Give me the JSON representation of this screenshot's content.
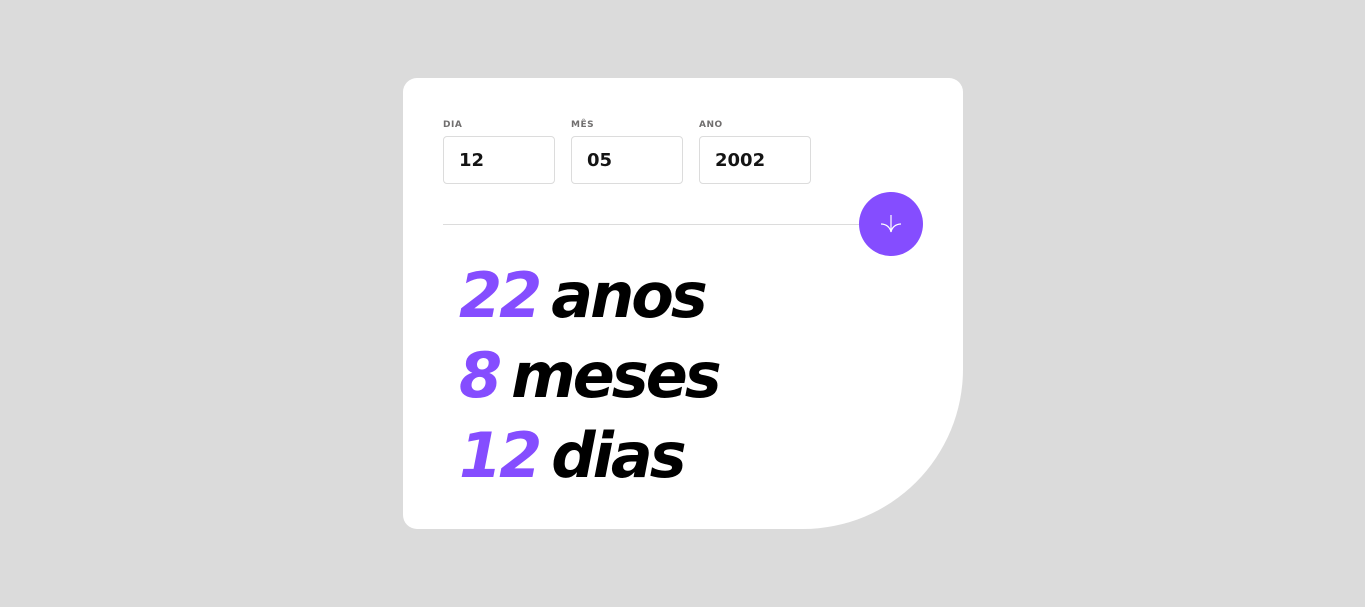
{
  "form": {
    "fields": [
      {
        "label": "DIA",
        "value": "12"
      },
      {
        "label": "MÊS",
        "value": "05"
      },
      {
        "label": "ANO",
        "value": "2002"
      }
    ],
    "submit_icon": "arrow-down-icon"
  },
  "results": [
    {
      "value": "22",
      "unit": "anos"
    },
    {
      "value": "8",
      "unit": "meses"
    },
    {
      "value": "12",
      "unit": "dias"
    }
  ],
  "colors": {
    "accent": "#854dff",
    "background": "#dbdbdb",
    "card": "#ffffff",
    "text": "#000000",
    "label": "#716f6f",
    "border": "#dcdcdc"
  }
}
